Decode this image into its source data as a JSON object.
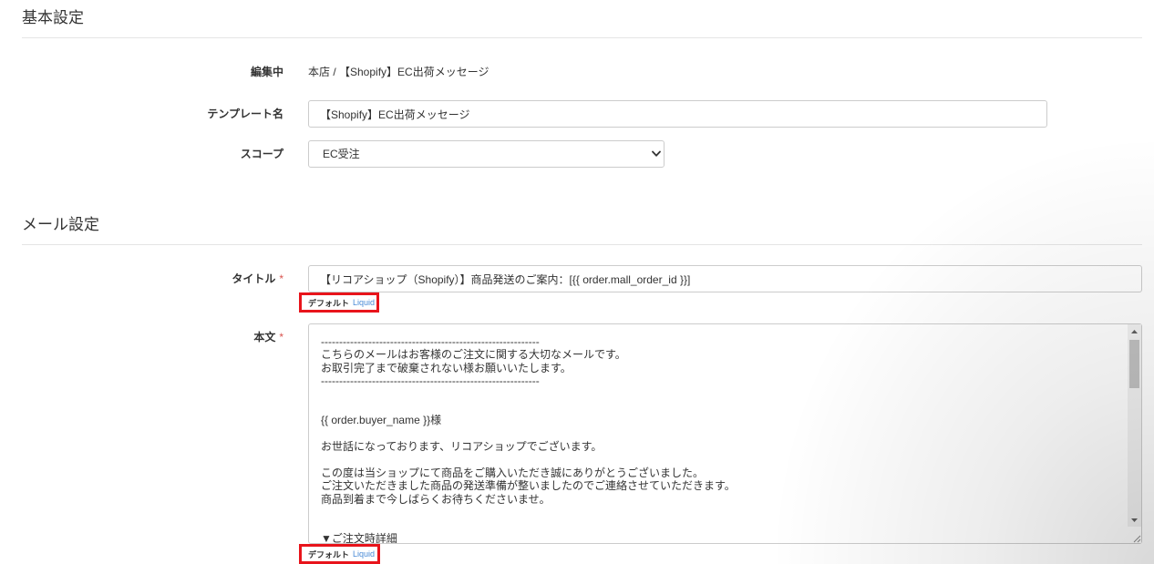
{
  "basic_settings": {
    "title": "基本設定",
    "editing": {
      "label": "編集中",
      "value": "本店 / 【Shopify】EC出荷メッセージ"
    },
    "template_name": {
      "label": "テンプレート名",
      "value": "【Shopify】EC出荷メッセージ"
    },
    "scope": {
      "label": "スコープ",
      "selected": "EC受注"
    }
  },
  "mail_settings": {
    "title": "メール設定",
    "subject": {
      "label": "タイトル",
      "required_mark": "*",
      "value": "【リコアショップ（Shopify）】商品発送のご案内：[{{ order.mall_order_id }}]",
      "badges": {
        "default": "デフォルト",
        "liquid": "Liquid"
      }
    },
    "body": {
      "label": "本文",
      "required_mark": "*",
      "value": "------------------------------------------------------------\nこちらのメールはお客様のご注文に関する大切なメールです。\nお取引完了まで破棄されない様お願いいたします。\n------------------------------------------------------------\n\n\n{{ order.buyer_name }}様\n\nお世話になっております、リコアショップでございます。\n\nこの度は当ショップにて商品をご購入いただき誠にありがとうございました。\nご注文いただきました商品の発送準備が整いましたのでご連絡させていただきます。\n商品到着まで今しばらくお待ちくださいませ。\n\n\n▼ご注文時詳細",
      "scroll": {
        "position_percent": 0,
        "visible_percent": 28
      },
      "badges": {
        "default": "デフォルト",
        "liquid": "Liquid"
      }
    }
  },
  "icons": {
    "scope_select_arrow": "chevron-down-icon",
    "scroll_up": "scroll-up-arrow-icon",
    "scroll_down": "scroll-down-arrow-icon",
    "resize": "resize-grip-icon"
  },
  "colors": {
    "text": "#333333",
    "border": "#cccccc",
    "divider": "#e5e5e5",
    "required": "#d9534f",
    "link": "#4a8bd6",
    "highlight": "#e8141b",
    "scrollbar_track": "#f1f1f1",
    "scrollbar_thumb": "#c1c1c1",
    "scrollbar_arrow": "#606060"
  }
}
